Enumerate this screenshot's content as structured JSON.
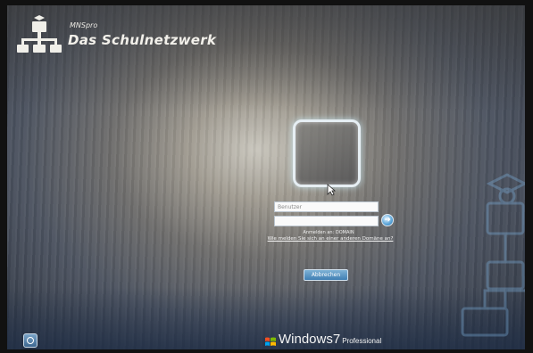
{
  "header": {
    "product_name": "MNSpro",
    "brand_title": "Das Schulnetzwerk",
    "logo_icon": "school-network-logo-icon"
  },
  "login": {
    "user_tile_icon": "user-tile-frame",
    "username_placeholder": "Benutzer",
    "password_placeholder": "",
    "submit_icon": "arrow-right-icon",
    "domain_notice": "Anmelden an: DOMAIN",
    "help_link": "Wie melden Sie sich an einer anderen Domäne an?",
    "cancel_button": "Abbrechen"
  },
  "footer": {
    "os_name": "Windows",
    "os_version": "7",
    "os_edition": "Professional",
    "ease_of_access_icon": "ease-of-access-icon"
  },
  "colors": {
    "accent_blue": "#5aa4d8",
    "text_light": "#f2f0ea"
  }
}
